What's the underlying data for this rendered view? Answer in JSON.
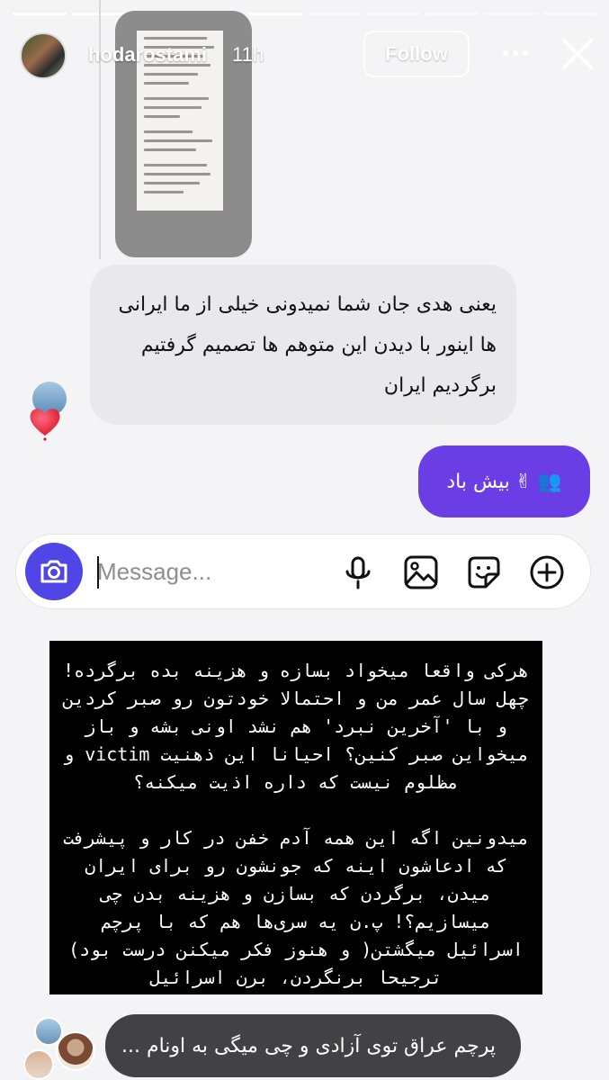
{
  "story": {
    "segments_total": 10,
    "segments_done": 5
  },
  "header": {
    "username": "hodarostami",
    "time": "11h",
    "follow_label": "Follow",
    "more_icon": "more-horizontal-icon",
    "close_icon": "close-icon"
  },
  "conversation": {
    "received_message": "یعنی هدی جان شما نمیدونی خیلی از ما ایرانی ها اینور با دیدن این متوهم ها تصمیم گرفتیم برگردیم ایران",
    "reaction": "heart",
    "sent_message": "بیش باد",
    "sent_emojis": [
      "✌",
      "👥"
    ]
  },
  "message_bar": {
    "placeholder": "Message...",
    "icons": [
      "camera-icon",
      "microphone-icon",
      "gallery-icon",
      "sticker-icon",
      "plus-circle-icon"
    ],
    "accent": "#4f46e5"
  },
  "text_card": {
    "paragraphs": [
      "هرکی واقعا میخواد بسازه و هزینه بده برگرده! چهل سال عمر من و احتمالا خودتون رو صبر کردین و با 'آخرین نبرد' هم نشد اونی بشه و باز میخواین صبر کنین؟ احیانا این ذهنیت victim و مظلوم نیست که داره اذیت میکنه؟",
      "میدونین اگه این همه آدم خفن در کار و پیشرفت که ادعاشون اینه که جونشون رو برای ایران میدن، برگردن که بسازن و هزینه بدن چی میسازیم؟! پ.ن یه سری‌ها هم که با پرچم اسرائیل میگشتن( و هنوز فکر میکنن درست بود) ترجیحا برنگردن، برن اسرائیل"
    ]
  },
  "reply": {
    "text": "پرچم عراق توی آزادی و چی میگی به اونام ..."
  },
  "colors": {
    "sent_bubble": "#6a3ee4",
    "received_bubble": "#e9e9ec",
    "reply_bubble": "#424246"
  }
}
